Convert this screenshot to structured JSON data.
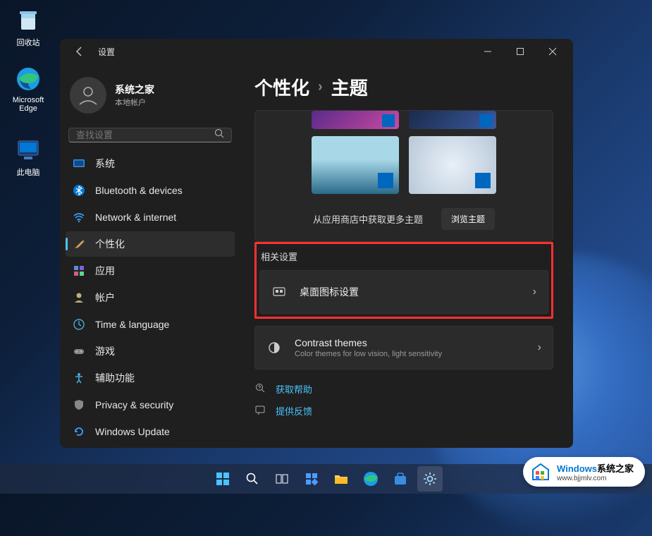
{
  "desktop": {
    "recycle": "回收站",
    "edge": "Microsoft Edge",
    "thispc": "此电脑"
  },
  "titlebar": {
    "title": "设置"
  },
  "profile": {
    "name": "系统之家",
    "sub": "本地帐户"
  },
  "search": {
    "placeholder": "查找设置"
  },
  "nav": {
    "system": "系统",
    "bluetooth": "Bluetooth & devices",
    "network": "Network & internet",
    "personalization": "个性化",
    "apps": "应用",
    "accounts": "帐户",
    "time": "Time & language",
    "gaming": "游戏",
    "accessibility": "辅助功能",
    "privacy": "Privacy & security",
    "update": "Windows Update"
  },
  "breadcrumb": {
    "parent": "个性化",
    "current": "主题"
  },
  "store": {
    "text": "从应用商店中获取更多主题",
    "button": "浏览主题"
  },
  "related": {
    "heading": "相关设置",
    "desktop_icons": {
      "title": "桌面图标设置"
    },
    "contrast": {
      "title": "Contrast themes",
      "sub": "Color themes for low vision, light sensitivity"
    }
  },
  "links": {
    "help": "获取帮助",
    "feedback": "提供反馈"
  },
  "watermark": {
    "brand_win": "Windows",
    "brand_rest": "系统之家",
    "url": "www.bjjmlv.com"
  }
}
